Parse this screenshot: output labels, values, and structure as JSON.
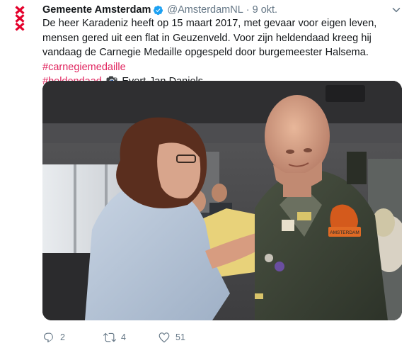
{
  "tweet": {
    "author_name": "Gemeente Amsterdam",
    "handle": "@AmsterdamNL",
    "separator": "·",
    "timestamp": "9 okt.",
    "text_main": "De heer Karadeniz heeft op 15 maart 2017, met gevaar voor eigen leven, mensen gered uit een flat in Geuzenveld. Voor zijn heldendaad kreeg hij vandaag de Carnegie Medaille opgespeld door burgemeester Halsema.",
    "hashtag_1": "#carnegiemedaille",
    "hashtag_2": "#heldendaad",
    "photo_credit": "Evert-Jan Daniels",
    "image_patch_text": "AMSTERDAM"
  },
  "actions": {
    "reply_count": "2",
    "retweet_count": "4",
    "like_count": "51"
  },
  "colors": {
    "hashtag": "#e0245e",
    "secondary_text": "#657786",
    "verified": "#1da1f2",
    "amsterdam_red": "#e4002b"
  },
  "icons": {
    "avatar": "amsterdam-xxx-logo",
    "verified": "verified-badge-icon",
    "caret": "chevron-down-icon",
    "camera": "camera-icon",
    "reply": "reply-icon",
    "retweet": "retweet-icon",
    "like": "heart-icon"
  }
}
